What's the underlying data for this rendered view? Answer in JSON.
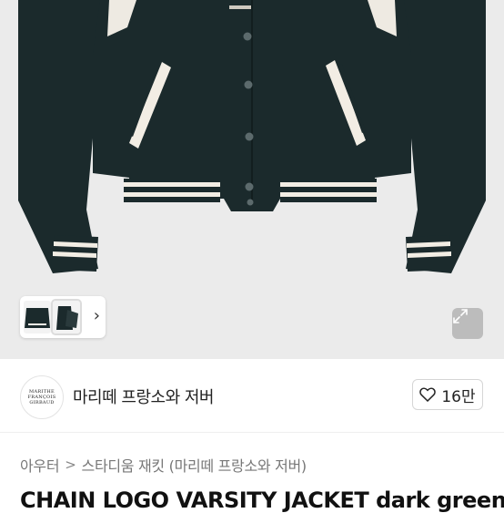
{
  "colors": {
    "jacket": "#1b2a2c",
    "stripe": "#f2ede4",
    "hero_bg": "#ebebeb",
    "accent_text": "#222222",
    "muted_text": "#777777"
  },
  "hero": {
    "image_icon": "jacket-product-image",
    "thumbnails_chevron": "chevron-right-icon",
    "expand_icon": "expand-icon"
  },
  "shop": {
    "logo_text_line1": "MARITHE",
    "logo_text_line2": "FRANÇOIS",
    "logo_text_line3": "GIRBAUD",
    "name": "마리떼 프랑소와 저버",
    "likes": "16만",
    "like_icon": "heart-icon"
  },
  "breadcrumb": {
    "level1": "아우터",
    "separator": ">",
    "level2": "스타디움 재킷 (마리떼 프랑소와 저버)"
  },
  "product": {
    "title": "CHAIN LOGO VARSITY JACKET dark green"
  }
}
